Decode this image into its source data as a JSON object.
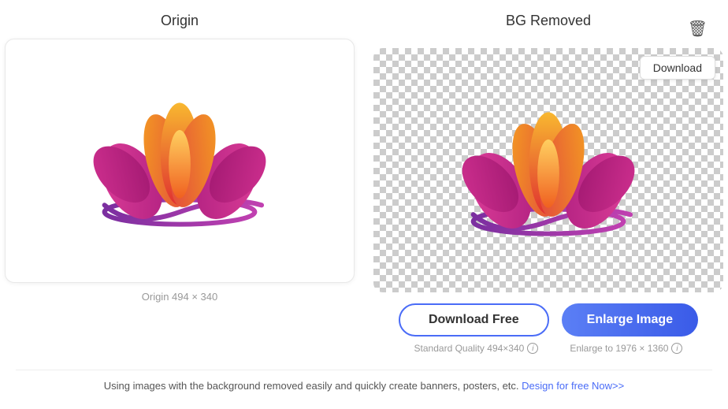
{
  "origin_panel": {
    "title": "Origin",
    "caption": "Origin 494 × 340"
  },
  "bg_removed_panel": {
    "title": "BG Removed"
  },
  "download_button": {
    "label": "Download"
  },
  "action_buttons": {
    "download_free_label": "Download Free",
    "enlarge_label": "Enlarge Image"
  },
  "quality": {
    "standard_label": "Standard Quality 494×340",
    "enlarge_label": "Enlarge to 1976 × 1360"
  },
  "footer": {
    "text": "Using images with the background removed easily and quickly create banners, posters, etc.",
    "link_text": "Design for free Now>>"
  },
  "icons": {
    "trash": "🗑",
    "info": "i"
  }
}
